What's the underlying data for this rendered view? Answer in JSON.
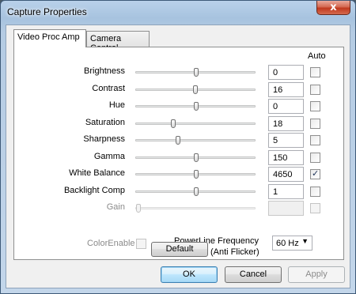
{
  "window": {
    "title": "Capture Properties",
    "close_glyph": "x"
  },
  "tabs": [
    {
      "label": "Video Proc Amp",
      "active": true
    },
    {
      "label": "Camera Control",
      "active": false
    }
  ],
  "panel": {
    "auto_header": "Auto",
    "properties": [
      {
        "label": "Brightness",
        "value": "0",
        "slider_position": 0.5,
        "auto": false,
        "enabled": true
      },
      {
        "label": "Contrast",
        "value": "16",
        "slider_position": 0.49,
        "auto": false,
        "enabled": true
      },
      {
        "label": "Hue",
        "value": "0",
        "slider_position": 0.5,
        "auto": false,
        "enabled": true
      },
      {
        "label": "Saturation",
        "value": "18",
        "slider_position": 0.3,
        "auto": false,
        "enabled": true
      },
      {
        "label": "Sharpness",
        "value": "5",
        "slider_position": 0.34,
        "auto": false,
        "enabled": true
      },
      {
        "label": "Gamma",
        "value": "150",
        "slider_position": 0.5,
        "auto": false,
        "enabled": true
      },
      {
        "label": "White Balance",
        "value": "4650",
        "slider_position": 0.5,
        "auto": true,
        "enabled": true
      },
      {
        "label": "Backlight Comp",
        "value": "1",
        "slider_position": 0.5,
        "auto": false,
        "enabled": true
      },
      {
        "label": "Gain",
        "value": "",
        "slider_position": 0.0,
        "auto": false,
        "enabled": false
      }
    ],
    "color_enable_label": "ColorEnable",
    "powerline_label_line1": "PowerLine Frequency",
    "powerline_label_line2": "(Anti Flicker)",
    "powerline_value": "60 Hz",
    "default_button": "Default"
  },
  "buttons": {
    "ok": "OK",
    "cancel": "Cancel",
    "apply": "Apply"
  }
}
